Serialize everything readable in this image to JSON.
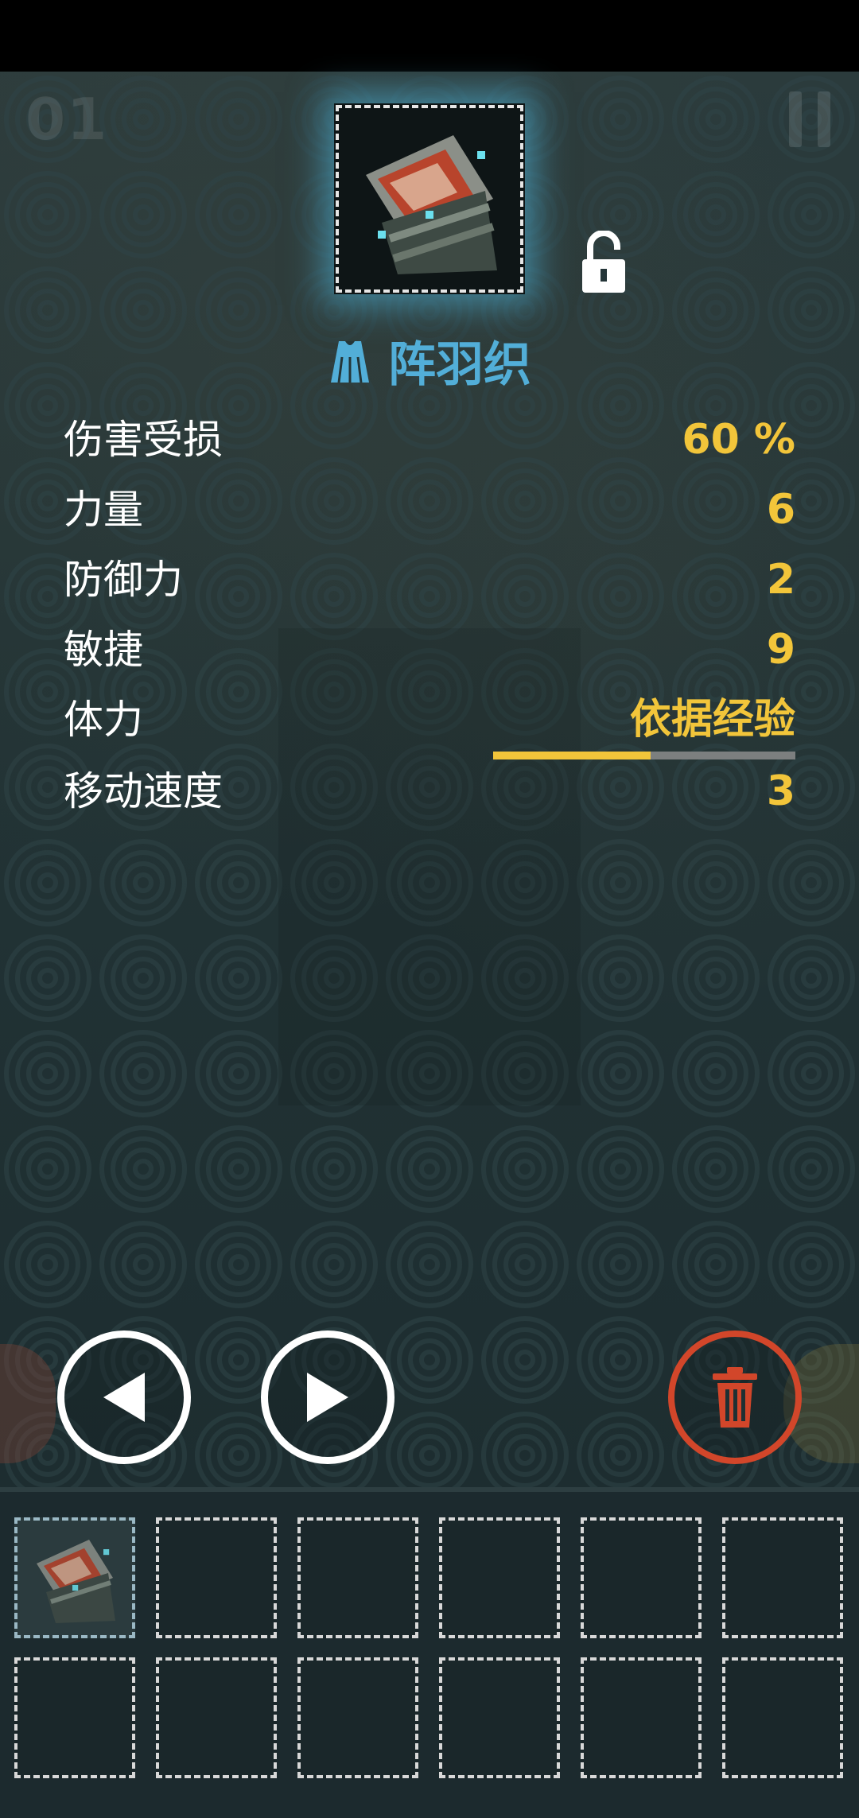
{
  "hud": {
    "level_counter": "01"
  },
  "item": {
    "name": "阵羽织",
    "icon": "haori-armor-sprite",
    "type_icon": "robe-icon",
    "lock_icon": "unlocked-padlock-icon"
  },
  "stats": [
    {
      "label": "伤害受损",
      "value": "60 %"
    },
    {
      "label": "力量",
      "value": "6"
    },
    {
      "label": "防御力",
      "value": "2"
    },
    {
      "label": "敏捷",
      "value": "9"
    },
    {
      "label": "体力",
      "value": "依据经验",
      "progress": 0.52
    },
    {
      "label": "移动速度",
      "value": "3"
    }
  ],
  "controls": {
    "prev_icon": "triangle-left-icon",
    "next_icon": "triangle-right-icon",
    "delete_icon": "trash-icon"
  },
  "inventory": {
    "slots_total": 12,
    "filled_slots": [
      0
    ]
  },
  "colors": {
    "title": "#52aed8",
    "value": "#f2c53a",
    "delete": "#d2462a",
    "glow": "#50bee6"
  }
}
